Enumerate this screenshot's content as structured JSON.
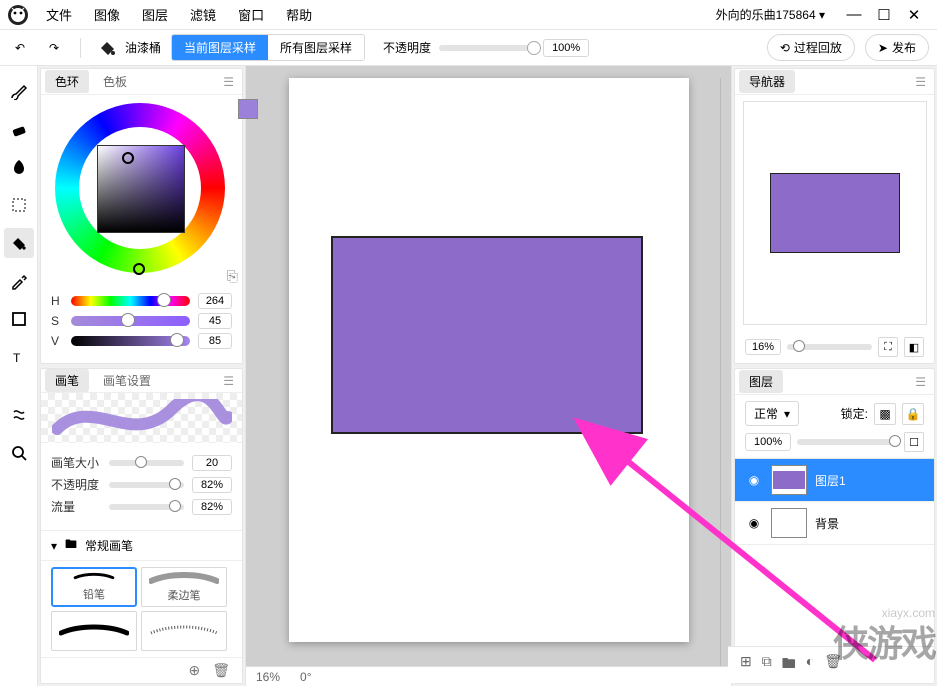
{
  "menubar": {
    "items": [
      "文件",
      "图像",
      "图层",
      "滤镜",
      "窗口",
      "帮助"
    ],
    "user": "外向的乐曲175864"
  },
  "toolbar": {
    "bucket_label": "油漆桶",
    "sample_current": "当前图层采样",
    "sample_all": "所有图层采样",
    "opacity_label": "不透明度",
    "opacity_value": "100%",
    "replay": "过程回放",
    "publish": "发布"
  },
  "canvas": {
    "footer_zoom": "16%",
    "footer_angle": "0°"
  },
  "color": {
    "tabs": [
      "色环",
      "色板"
    ],
    "H_label": "H",
    "H_value": "264",
    "S_label": "S",
    "S_value": "45",
    "V_label": "V",
    "V_value": "85",
    "fg": "#9c81db",
    "bg": "#2138d0"
  },
  "brush": {
    "tabs": [
      "画笔",
      "画笔设置"
    ],
    "size_label": "画笔大小",
    "size_value": "20",
    "opacity_label": "不透明度",
    "opacity_value": "82%",
    "flow_label": "流量",
    "flow_value": "82%",
    "category": "常规画笔",
    "presets": [
      "铅笔",
      "柔边笔",
      "",
      ""
    ]
  },
  "navigator": {
    "title": "导航器",
    "zoom": "16%"
  },
  "layers": {
    "title": "图层",
    "blend": "正常",
    "lock_label": "锁定:",
    "opacity": "100%",
    "items": [
      {
        "name": "图层1",
        "selected": true
      },
      {
        "name": "背景",
        "selected": false
      }
    ]
  },
  "watermark": {
    "site": "xiayx.com",
    "brand": "侠游戏"
  }
}
